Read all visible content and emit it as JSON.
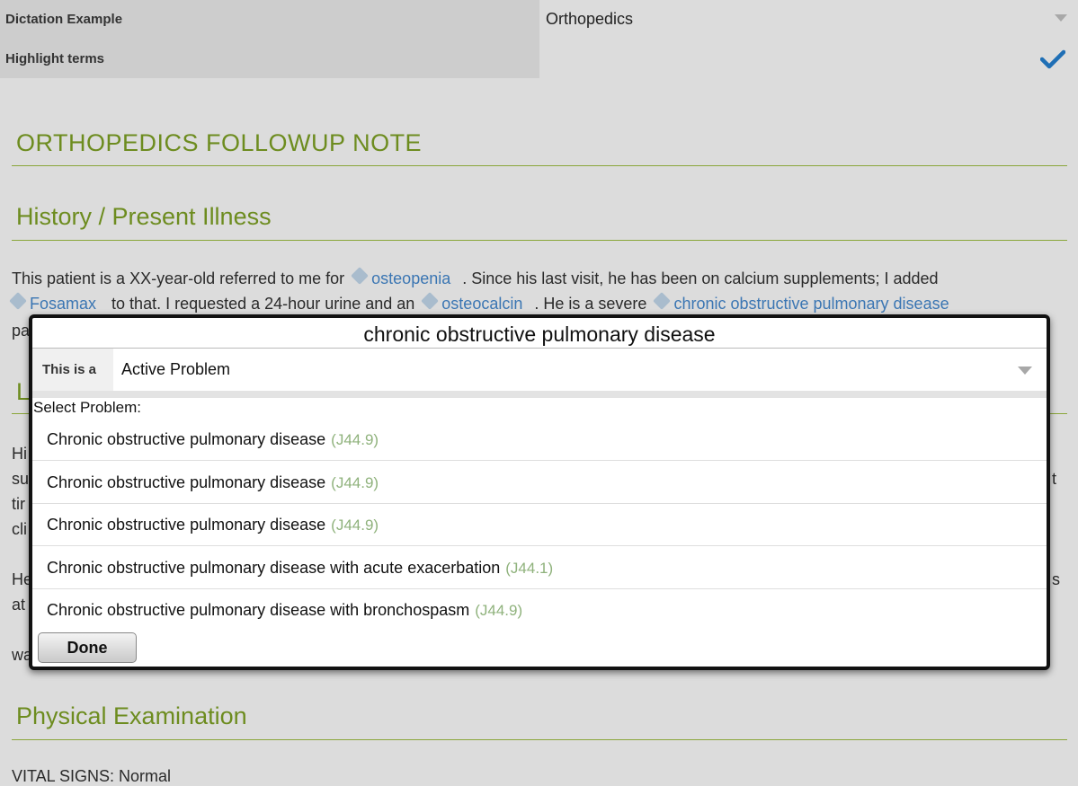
{
  "settings": {
    "dictation_label": "Dictation Example",
    "dictation_value": "Orthopedics",
    "highlight_label": "Highlight terms"
  },
  "document": {
    "title": "ORTHOPEDICS FOLLOWUP NOTE",
    "history_heading": "History / Present Illness",
    "history_line1_a": "This patient is a XX-year-old referred to me for",
    "term_osteopenia": "osteopenia",
    "history_line1_b": ". Since his last visit, he has been on calcium supplements; I added",
    "term_fosamax": "Fosamax",
    "history_line2_a": "to that. I requested a 24-hour urine and an",
    "term_osteocalcin": "osteocalcin",
    "history_line2_b": ". He is a severe",
    "term_copd": "chronic obstructive pulmonary disease",
    "frag_pa": "pa",
    "frag_L": "L",
    "frag_hi": "Hi",
    "frag_su": "su",
    "frag_tir": "tir",
    "frag_cli": "cli",
    "frag_t": "t",
    "frag_he": "He",
    "frag_at": "at",
    "frag_s": "s",
    "frag_wa": "wa",
    "physical_heading": "Physical Examination",
    "vitals_partial": "VITAL SIGNS: Normal"
  },
  "dialog": {
    "title": "chronic obstructive pulmonary disease",
    "type_label": "This is a",
    "type_value": "Active Problem",
    "select_label": "Select Problem:",
    "problems": [
      {
        "name": "Chronic obstructive pulmonary disease",
        "code": "(J44.9)"
      },
      {
        "name": "Chronic obstructive pulmonary disease",
        "code": "(J44.9)"
      },
      {
        "name": "Chronic obstructive pulmonary disease",
        "code": "(J44.9)"
      },
      {
        "name": "Chronic obstructive pulmonary disease with acute exacerbation",
        "code": "(J44.1)"
      },
      {
        "name": "Chronic obstructive pulmonary disease with bronchospasm",
        "code": "(J44.9)"
      }
    ],
    "done_label": "Done"
  },
  "colors": {
    "heading_green": "#6d8c1f",
    "term_blue": "#3b76b3",
    "code_green": "#8fb27c",
    "check_blue": "#1f6fb5"
  }
}
